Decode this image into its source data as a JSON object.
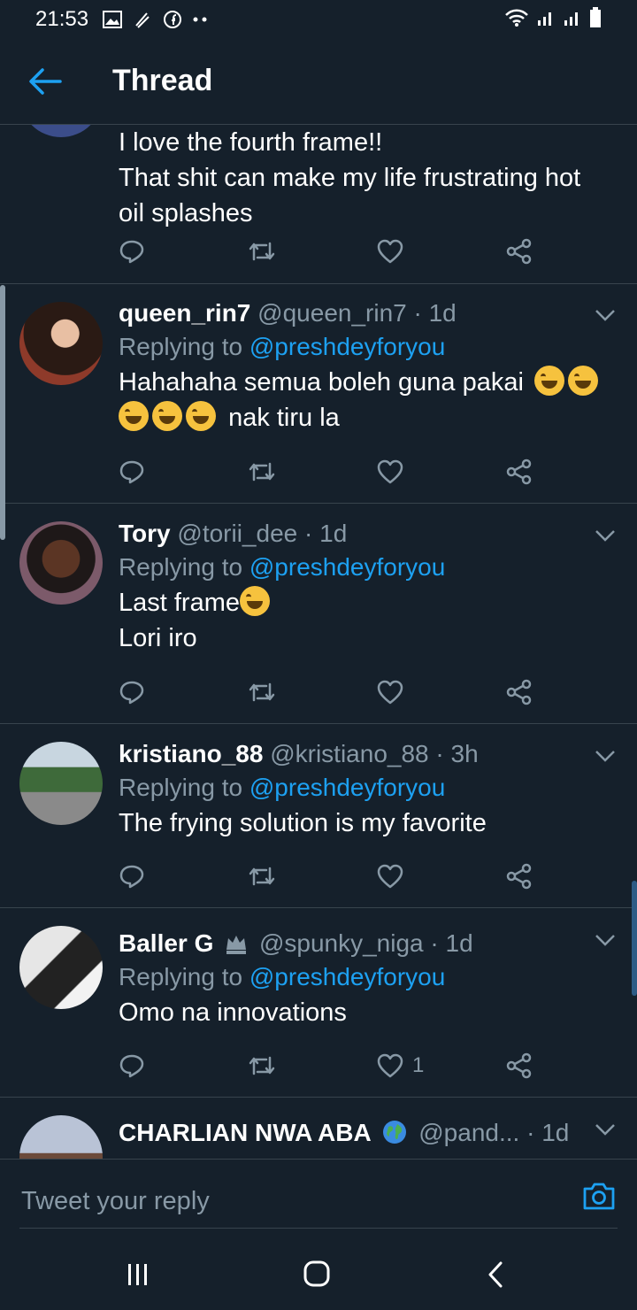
{
  "status": {
    "time": "21:53"
  },
  "appbar": {
    "title": "Thread"
  },
  "tweets": [
    {
      "lines": [
        "I love the fourth frame!!",
        "That shit can make my life frustrating hot",
        "oil splashes"
      ]
    },
    {
      "name": "queen_rin7",
      "handle": "@queen_rin7",
      "time": "1d",
      "replying_label": "Replying to",
      "replying_to": "@preshdeyforyou",
      "line1": "Hahahaha semua boleh guna pakai",
      "line2": "nak tiru la"
    },
    {
      "name": "Tory",
      "handle": "@torii_dee",
      "time": "1d",
      "replying_label": "Replying to",
      "replying_to": "@preshdeyforyou",
      "line1": "Last frame",
      "line2": "Lori iro"
    },
    {
      "name": "kristiano_88",
      "handle": "@kristiano_88",
      "time": "3h",
      "replying_label": "Replying to",
      "replying_to": "@preshdeyforyou",
      "line1": "The frying solution is my favorite"
    },
    {
      "name": "Baller G",
      "handle": "@spunky_niga",
      "time": "1d",
      "replying_label": "Replying to",
      "replying_to": "@preshdeyforyou",
      "line1": "Omo na innovations",
      "likes": "1"
    },
    {
      "name": "CHARLIAN NWA ABA",
      "handle": "@pand...",
      "time": "1d"
    }
  ],
  "composer": {
    "placeholder": "Tweet your reply"
  },
  "icons": {
    "reply": "reply-icon",
    "retweet": "retweet-icon",
    "like": "heart-icon",
    "share": "share-icon",
    "camera": "camera-icon",
    "back": "back-arrow-icon"
  },
  "colors": {
    "background": "#15202b",
    "accent": "#1da1f2",
    "secondary": "#8899a6",
    "divider": "#38444d"
  }
}
